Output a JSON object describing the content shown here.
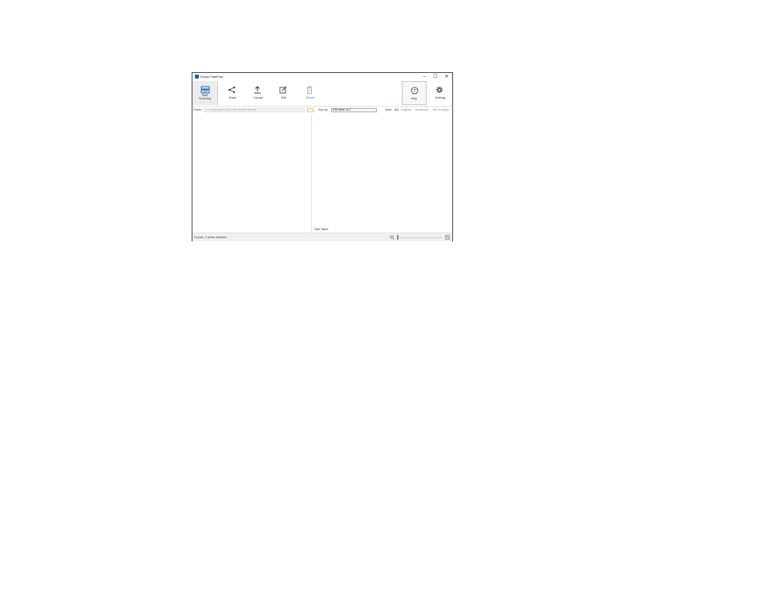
{
  "window": {
    "title": "Epson FastFoto",
    "controls": {
      "minimize": "–",
      "maximize": "☐",
      "close": "✕"
    }
  },
  "toolbar": {
    "start_scanning_label": "Start\nScanning",
    "share_label": "Share",
    "upload_label": "Upload",
    "edit_label": "Edit",
    "delete_label": "Delete",
    "help_label": "Help",
    "settings_label": "Settings"
  },
  "filterbar": {
    "folder_label": "Folder:",
    "folder_value": "C:\\Users\\Epson Docs Lab\\Pictures\\FastFoto",
    "sort_label": "Sort by:",
    "sort_value": "File name: A-Z",
    "view_label": "View:",
    "view_options": [
      "All",
      "Original",
      "Enhanced",
      "Text on Back"
    ],
    "view_selected": "All"
  },
  "content": {
    "date_taken_label": "Date Taken:"
  },
  "statusbar": {
    "status_text": "0 photo, 0 photo selected"
  },
  "colors": {
    "accent": "#1a5fb4",
    "folder_icon": "#e8b53a"
  },
  "icons": {
    "app": "epson-logo-icon",
    "start_scanning": "scanner-icon",
    "share": "share-icon",
    "upload": "upload-icon",
    "edit": "edit-icon",
    "delete": "trash-icon",
    "help": "help-icon",
    "settings": "gear-icon",
    "folder": "folder-icon",
    "zoom_out": "zoom-out-icon",
    "zoom_in": "zoom-in-icon"
  }
}
